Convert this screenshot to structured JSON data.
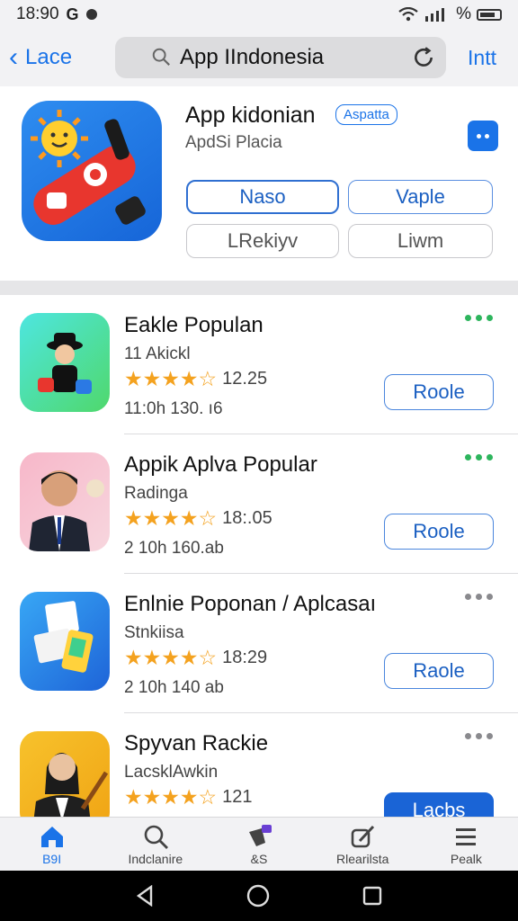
{
  "status": {
    "time": "18:90",
    "right_text": "%"
  },
  "nav": {
    "back_label": "Lace",
    "search_text": "App IIndonesia",
    "right_label": "Intt"
  },
  "hero": {
    "title": "App kidonian",
    "badge": "Aspatta",
    "subtitle": "ApdSi Placia",
    "buttons": [
      "Naso",
      "Vaple",
      "LRekiyv",
      "Liwm"
    ]
  },
  "apps": [
    {
      "title": "Eakle Populan",
      "subtitle": "11 Akickl",
      "rating_value": "12.25",
      "stars": 4,
      "meta": "11:0h 130. ı6",
      "button": "Roole",
      "dots_color": "#2db55d",
      "button_filled": false
    },
    {
      "title": "Appik Aplva Popular",
      "subtitle": "Radinga",
      "rating_value": "18:.05",
      "stars": 4,
      "meta": "2 10h 160.ab",
      "button": "Roole",
      "dots_color": "#2db55d",
      "button_filled": false
    },
    {
      "title": "Enlnie Poponan / Aplcasaı",
      "subtitle": "Stnkiisa",
      "rating_value": "18:29",
      "stars": 4,
      "meta": "2 10h 140 ab",
      "button": "Raole",
      "dots_color": "#8a8a8e",
      "button_filled": false
    },
    {
      "title": "Spyvan Rackie",
      "subtitle": "LacsklAwkin",
      "rating_value": "121",
      "stars": 4,
      "meta": "",
      "button": "Lacbs",
      "dots_color": "#8a8a8e",
      "button_filled": true
    }
  ],
  "tabs": [
    {
      "label": "B9I",
      "icon": "home-icon",
      "active": true
    },
    {
      "label": "Indclanire",
      "icon": "search-icon",
      "active": false
    },
    {
      "label": "&S",
      "icon": "games-icon",
      "active": false
    },
    {
      "label": "Rlearilsta",
      "icon": "edit-icon",
      "active": false
    },
    {
      "label": "Pealk",
      "icon": "menu-icon",
      "active": false
    }
  ],
  "colors": {
    "accent": "#1a73e8",
    "star": "#f4a21f"
  }
}
